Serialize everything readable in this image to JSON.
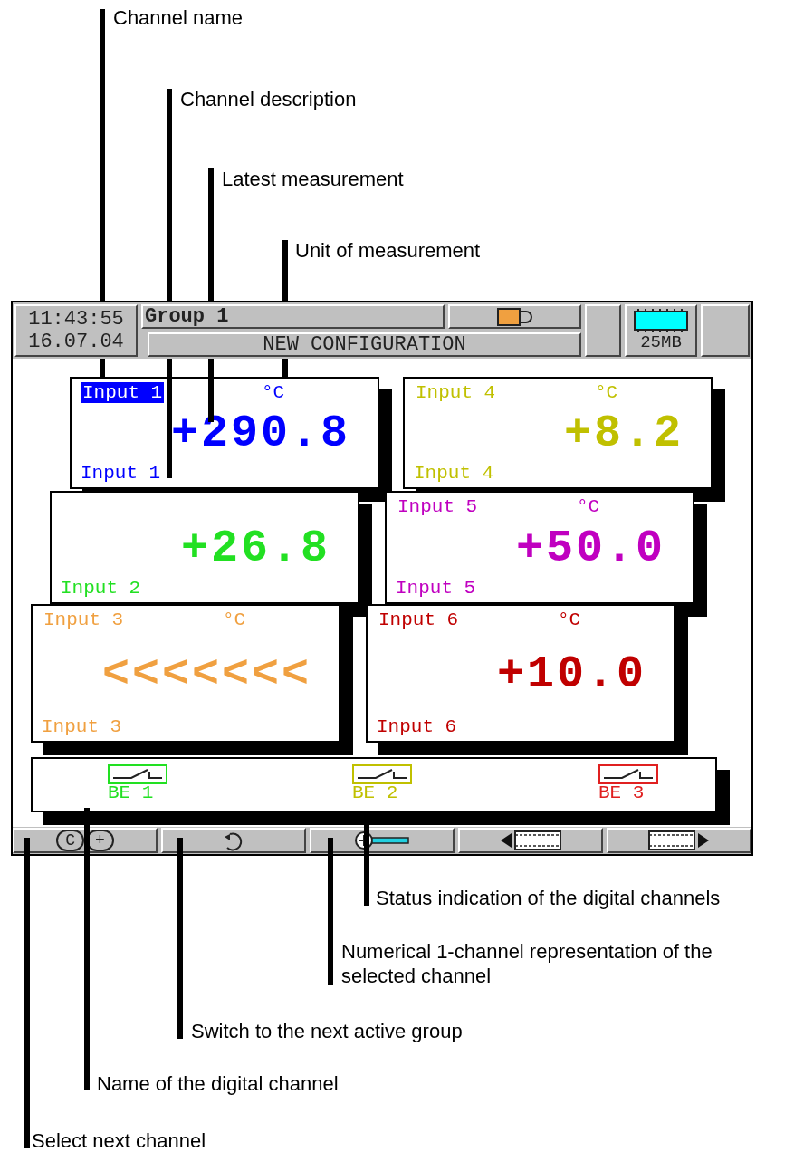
{
  "callouts_top": [
    {
      "text": "Channel name"
    },
    {
      "text": "Channel description"
    },
    {
      "text": "Latest measurement"
    },
    {
      "text": "Unit of measurement"
    }
  ],
  "header": {
    "time": "11:43:55",
    "date": "16.07.04",
    "group": "Group 1",
    "status": "NEW CONFIGURATION",
    "memory": "25MB"
  },
  "channels": [
    {
      "name": "Input 1",
      "unit": "°C",
      "value": "+290.8",
      "description": "Input 1",
      "color": "#0000ff",
      "selected": true
    },
    {
      "name": "Input 4",
      "unit": "°C",
      "value": "+8.2",
      "description": "Input 4",
      "color": "#c0c000",
      "selected": false
    },
    {
      "value": "+26.8",
      "description": "Input 2",
      "color": "#22e022"
    },
    {
      "name": "Input 5",
      "unit": "°C",
      "value": "+50.0",
      "description": "Input 5",
      "color": "#c000c0",
      "selected": false
    },
    {
      "name": "Input 3",
      "unit": "°C",
      "value": "<<<<<<<",
      "description": "Input 3",
      "color": "#f0a040",
      "selected": false
    },
    {
      "name": "Input 6",
      "unit": "°C",
      "value": "+10.0",
      "description": "Input 6",
      "color": "#c00000",
      "selected": false
    }
  ],
  "digital_channels": [
    {
      "name": "BE 1",
      "color": "#22e022"
    },
    {
      "name": "BE 2",
      "color": "#c0c000"
    },
    {
      "name": "BE 3",
      "color": "#e02020"
    }
  ],
  "softkeys": [
    {
      "kind": "keys",
      "keys": [
        "C",
        "+"
      ]
    },
    {
      "kind": "rotate"
    },
    {
      "kind": "key"
    },
    {
      "kind": "prev"
    },
    {
      "kind": "next"
    }
  ],
  "callouts_bottom": [
    {
      "text": "Status indication of the digital channels"
    },
    {
      "text": "Numerical 1-channel representation of the selected channel"
    },
    {
      "text": "Switch to the next active group"
    },
    {
      "text": "Name of the digital channel"
    },
    {
      "text": "Select next channel"
    }
  ]
}
